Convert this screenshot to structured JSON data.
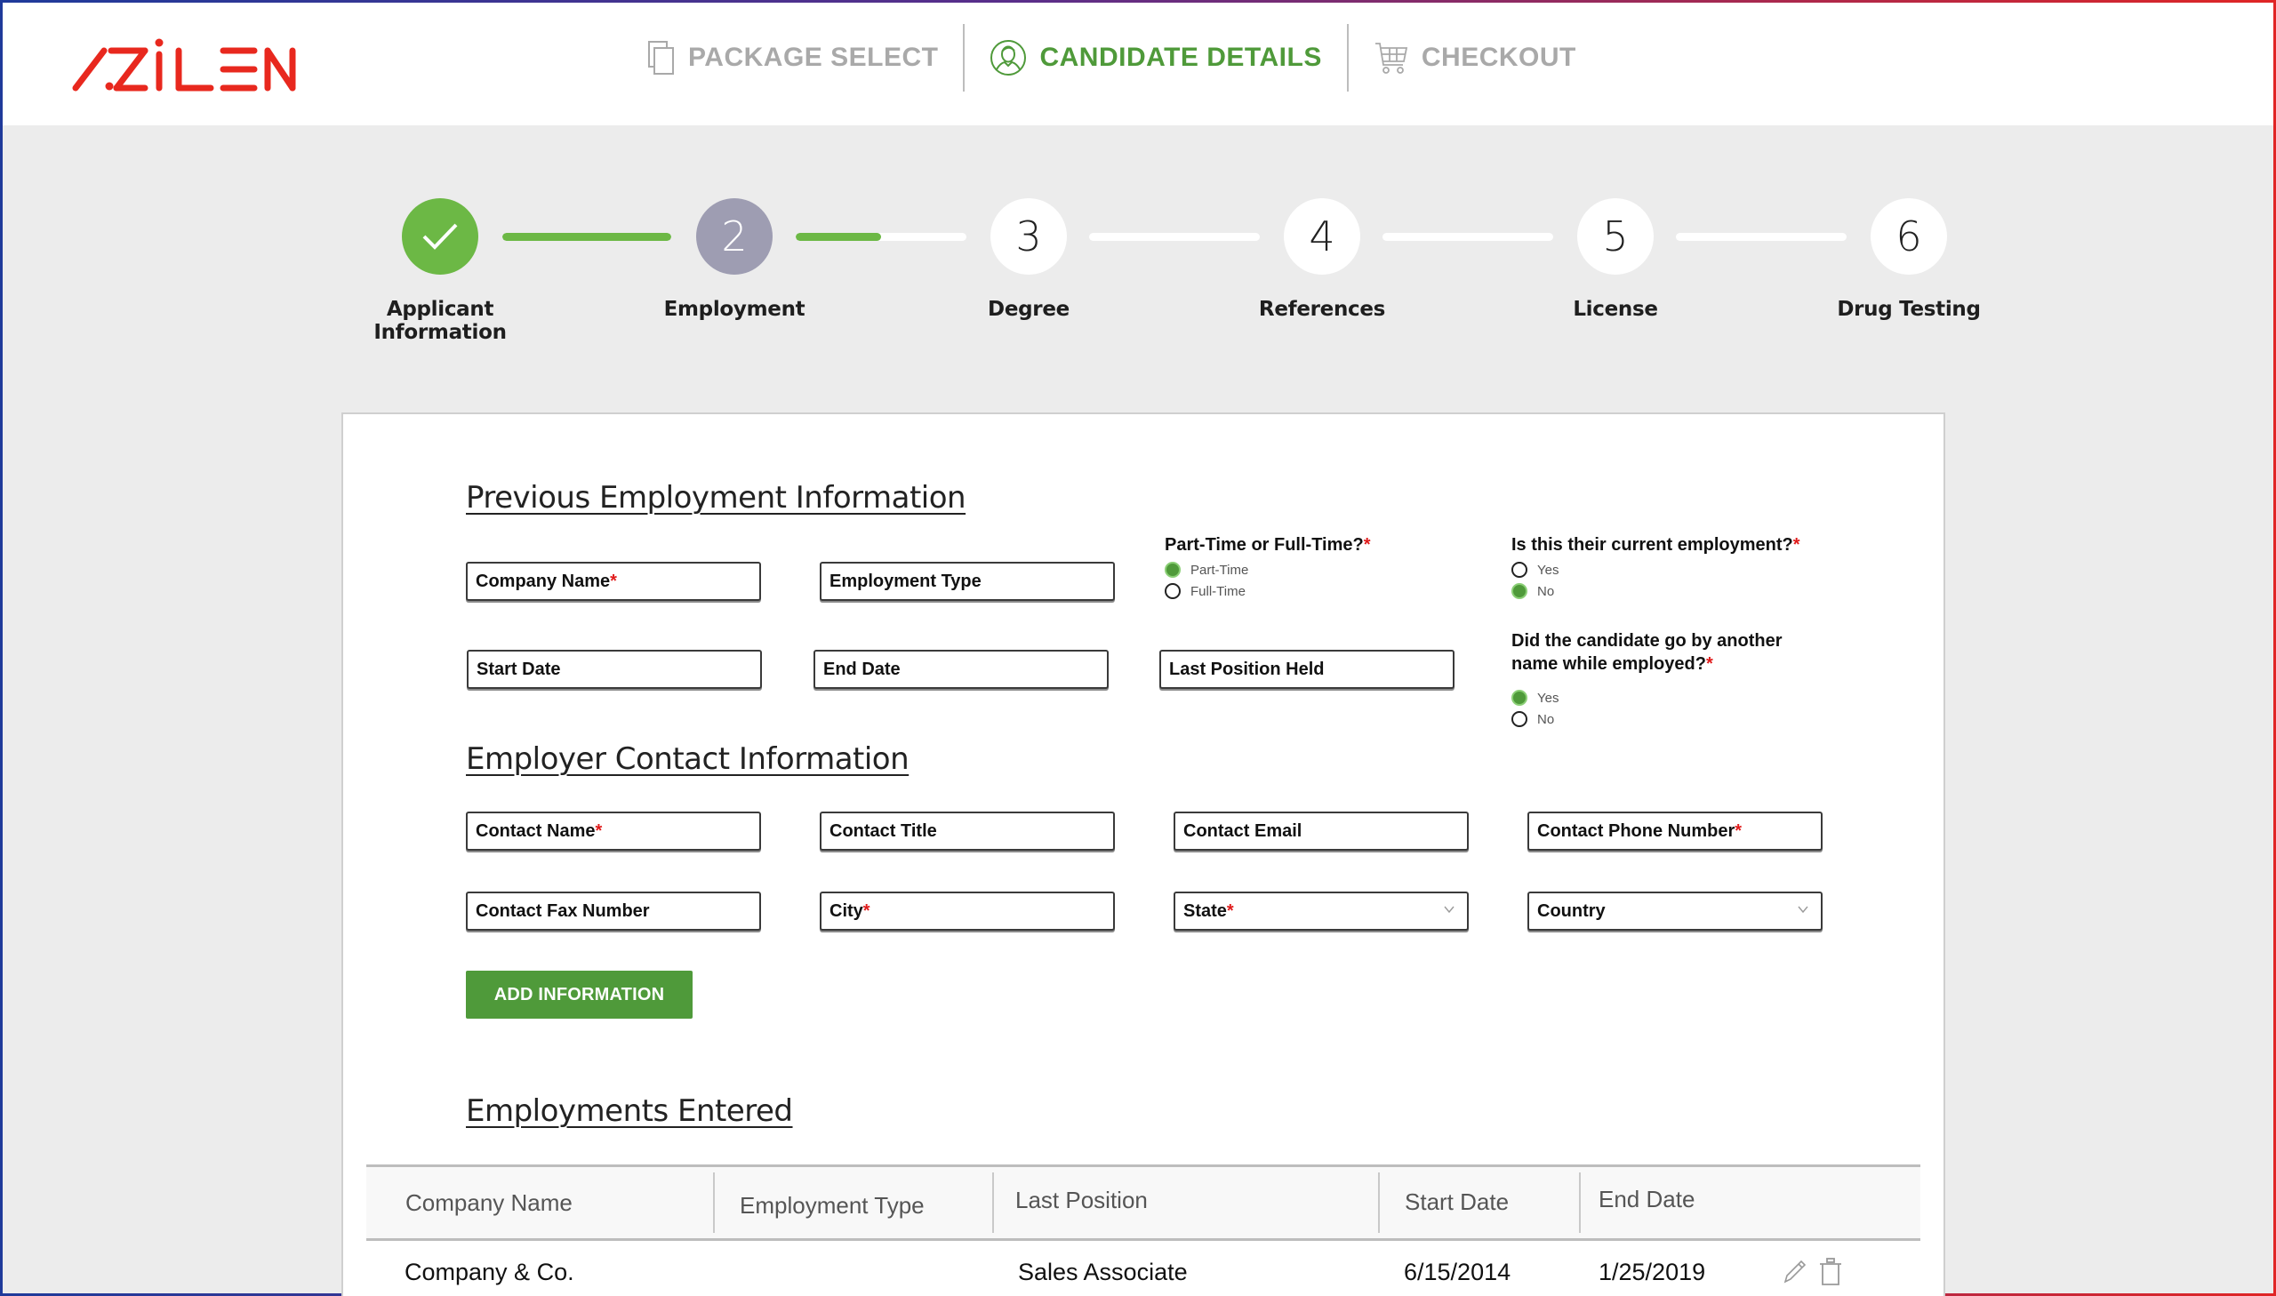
{
  "brand": {
    "logo_text": "AZILEN",
    "logo_color": "#e8281e"
  },
  "topnav": {
    "items": [
      {
        "label": "PACKAGE SELECT",
        "icon": "document-copy-icon",
        "state": "inactive"
      },
      {
        "label": "CANDIDATE DETAILS",
        "icon": "user-circle-icon",
        "state": "active"
      },
      {
        "label": "CHECKOUT",
        "icon": "shopping-cart-icon",
        "state": "inactive"
      }
    ],
    "active_color": "#4f9a3a",
    "inactive_color": "#a9a9a9"
  },
  "stepper": {
    "steps": [
      {
        "number": "",
        "label": "Applicant Information",
        "state": "done",
        "icon": "checkmark-icon"
      },
      {
        "number": "2",
        "label": "Employment",
        "state": "current"
      },
      {
        "number": "3",
        "label": "Degree",
        "state": "upcoming"
      },
      {
        "number": "4",
        "label": "References",
        "state": "upcoming"
      },
      {
        "number": "5",
        "label": "License",
        "state": "upcoming"
      },
      {
        "number": "6",
        "label": "Drug Testing",
        "state": "upcoming"
      }
    ],
    "connector_progress": [
      1.0,
      0.5,
      0,
      0,
      0
    ],
    "done_color": "#6cb845",
    "current_color": "#9e9db2"
  },
  "form": {
    "previous_employment_title": "Previous Employment Information",
    "fields": {
      "company_name": {
        "label": "Company Name",
        "required": "*"
      },
      "employment_type": {
        "label": "Employment Type",
        "required": ""
      },
      "start_date": {
        "label": "Start Date",
        "required": ""
      },
      "end_date": {
        "label": "End Date",
        "required": ""
      },
      "last_position": {
        "label": "Last Position Held",
        "required": ""
      }
    },
    "part_full_time": {
      "question": "Part-Time or Full-Time?",
      "required": "*",
      "options": [
        "Part-Time",
        "Full-Time"
      ],
      "selected": "Part-Time"
    },
    "current_employment": {
      "question": "Is this their current employment?",
      "required": "*",
      "options": [
        "Yes",
        "No"
      ],
      "selected": "No"
    },
    "another_name": {
      "question": "Did the candidate go by another name while employed?",
      "required": "*",
      "options": [
        "Yes",
        "No"
      ],
      "selected": "Yes"
    },
    "employer_contact_title": "Employer Contact Information",
    "contact_fields": {
      "contact_name": {
        "label": "Contact Name",
        "required": "*"
      },
      "contact_title": {
        "label": "Contact Title",
        "required": ""
      },
      "contact_email": {
        "label": "Contact Email",
        "required": ""
      },
      "contact_phone": {
        "label": "Contact Phone Number",
        "required": "*"
      },
      "contact_fax": {
        "label": "Contact Fax Number",
        "required": ""
      },
      "city": {
        "label": "City",
        "required": "*"
      },
      "state": {
        "label": "State",
        "required": "*"
      },
      "country": {
        "label": "Country",
        "required": ""
      }
    },
    "add_button_label": "ADD INFORMATION"
  },
  "employments": {
    "title": "Employments Entered",
    "columns": [
      "Company Name",
      "Employment Type",
      "Last Position",
      "Start Date",
      "End Date"
    ],
    "rows": [
      {
        "company": "Company & Co.",
        "type": "",
        "position": "Sales Associate",
        "start": "6/15/2014",
        "end": "1/25/2019"
      }
    ]
  }
}
